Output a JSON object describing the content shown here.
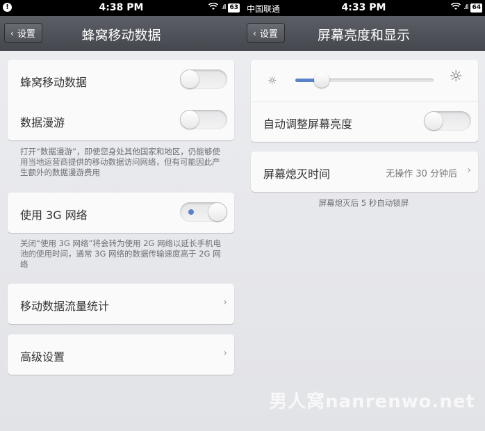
{
  "left_screen": {
    "status": {
      "alert": "!",
      "time": "4:38 PM",
      "signal": ".ıll",
      "battery": "63"
    },
    "back_label": "设置",
    "title": "蜂窝移动数据",
    "cellular_card": {
      "cellular_label": "蜂窝移动数据",
      "roaming_label": "数据漫游"
    },
    "roaming_note": "打开“数据漫游”，即使您身处其他国家和地区，仍能够使用当地运营商提供的移动数据访问网络，但有可能因此产生额外的数据漫游费用",
    "network_label": "使用 3G 网络",
    "network_note": "关闭“使用 3G 网络”将会转为使用 2G 网络以延长手机电池的使用时间，通常 3G 网络的数据传输速度高于 2G 网络",
    "usage_label": "移动数据流量统计",
    "advanced_label": "高级设置"
  },
  "right_screen": {
    "status": {
      "carrier": "中国联通",
      "time": "4:33 PM",
      "signal": ".ıll",
      "battery": "64"
    },
    "back_label": "设置",
    "title": "屏幕亮度和显示",
    "brightness_level": 0.19,
    "auto_brightness_label": "自动调整屏幕亮度",
    "screen_off_label": "屏幕熄灭时间",
    "screen_off_value": "无操作 30 分钟后",
    "lock_note": "屏幕熄灭后 5 秒自动锁屏"
  },
  "watermark": "男人窝nanrenwo.net",
  "colors": {
    "accent": "#5b82c8",
    "titlebar": "#4f5258"
  }
}
